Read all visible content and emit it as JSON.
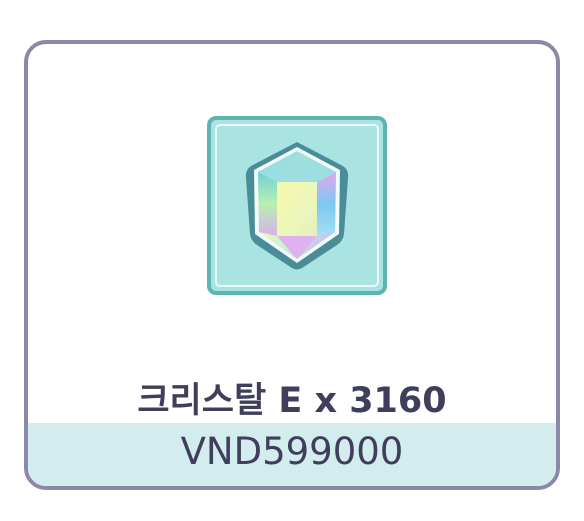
{
  "product": {
    "name": "크리스탈 E x 3160",
    "price": "VND599000",
    "icon": "crystal-gem-icon"
  },
  "colors": {
    "border": "#8b89a9",
    "icon_bg": "#a9e4e2",
    "band": "#d3ecee",
    "text": "#3f3e5b"
  }
}
